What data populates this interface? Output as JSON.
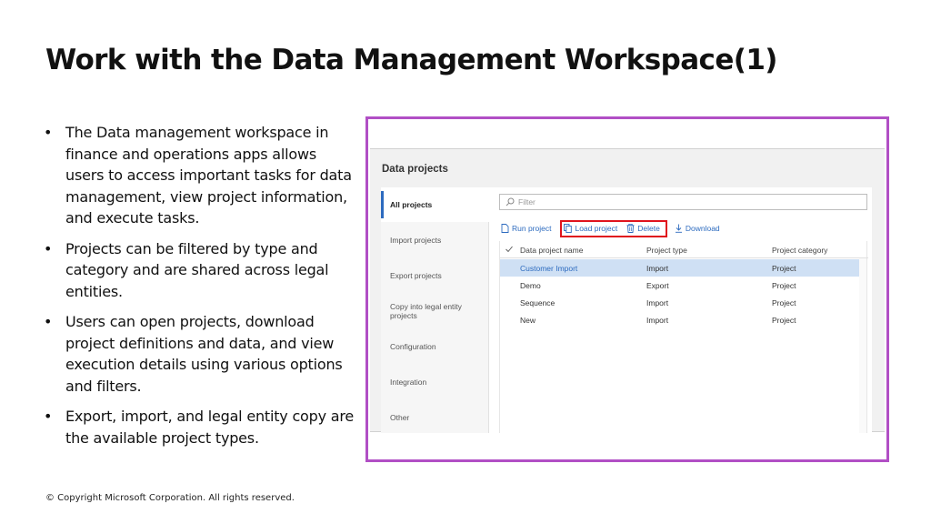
{
  "slide": {
    "title": "Work with the Data Management Workspace(1)",
    "bullets": [
      "The Data management workspace in finance and operations apps allows users to access important tasks for data management, view project information, and execute tasks.",
      "Projects can be filtered by type and category and are shared across legal entities.",
      "Users can open projects, download project definitions and data, and view execution details using various options and filters.",
      "Export, import, and legal entity copy are the available project types."
    ],
    "footer": "© Copyright Microsoft Corporation. All rights reserved."
  },
  "colors": {
    "frame_border": "#b14fc5",
    "highlight_border": "#e0131d",
    "accent": "#2d6bbf",
    "selected_row": "#cfe0f4"
  },
  "app": {
    "title": "Data projects",
    "nav": [
      "All projects",
      "Import projects",
      "Export projects",
      "Copy into legal entity projects",
      "Configuration",
      "Integration",
      "Other"
    ],
    "active_nav": "All projects",
    "filter_placeholder": "Filter",
    "toolbar": {
      "run": "Run project",
      "load": "Load project",
      "delete": "Delete",
      "download": "Download"
    },
    "icons": [
      "search-icon",
      "run-icon",
      "load-icon",
      "delete-icon",
      "download-icon",
      "check-icon"
    ],
    "grid": {
      "headers": [
        "Data project name",
        "Project type",
        "Project category"
      ],
      "rows": [
        [
          "Customer Import",
          "Import",
          "Project"
        ],
        [
          "Demo",
          "Export",
          "Project"
        ],
        [
          "Sequence",
          "Import",
          "Project"
        ],
        [
          "New",
          "Import",
          "Project"
        ]
      ],
      "selected_row": "Customer Import"
    }
  }
}
